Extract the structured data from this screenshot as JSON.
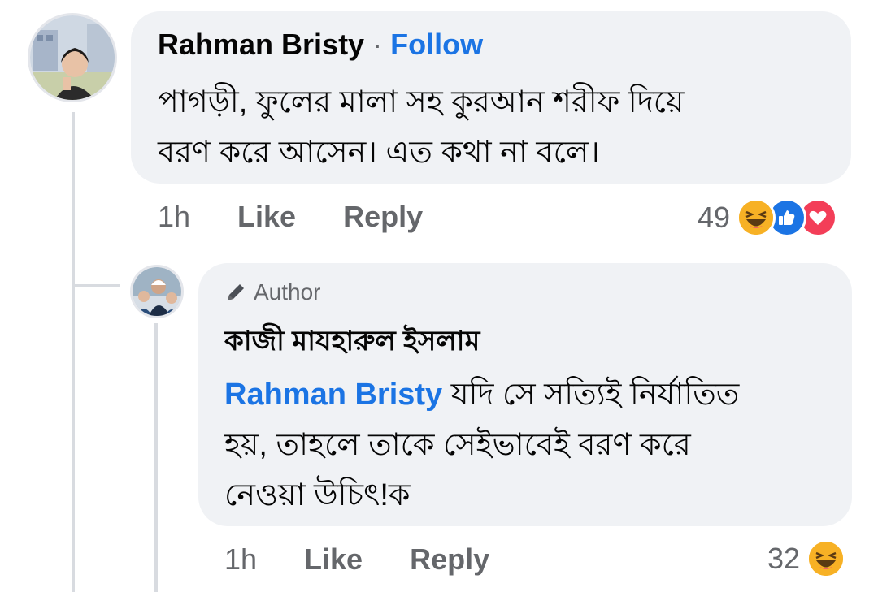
{
  "comment": {
    "author": "Rahman Bristy",
    "separator": "·",
    "follow_label": "Follow",
    "text_line1": "পাগড়ী, ফুলের মালা সহ কুরআন শরীফ দিয়ে",
    "text_line2": "বরণ করে আসেন। এত কথা না বলে।",
    "time": "1h",
    "like_label": "Like",
    "reply_label": "Reply",
    "reaction_count": "49",
    "reactions": [
      "haha-icon",
      "like-icon",
      "love-icon"
    ]
  },
  "reply": {
    "badge_label": "Author",
    "author": "কাজী মাযহারুল ইসলাম",
    "mention": "Rahman Bristy",
    "text_line1": " যদি সে সত্যিই নির্যাতিত",
    "text_line2": "হয়, তাহলে তাকে সেইভাবেই বরণ করে",
    "text_line3": "নেওয়া উচিৎ!ক",
    "time": "1h",
    "like_label": "Like",
    "reply_label": "Reply",
    "reaction_count": "32",
    "reactions": [
      "haha-icon"
    ]
  },
  "colors": {
    "bubble": "#f0f2f5",
    "link_blue": "#1b74e4",
    "meta_gray": "#65676b",
    "love_red": "#f33e58",
    "haha_yellow": "#f7b125"
  }
}
